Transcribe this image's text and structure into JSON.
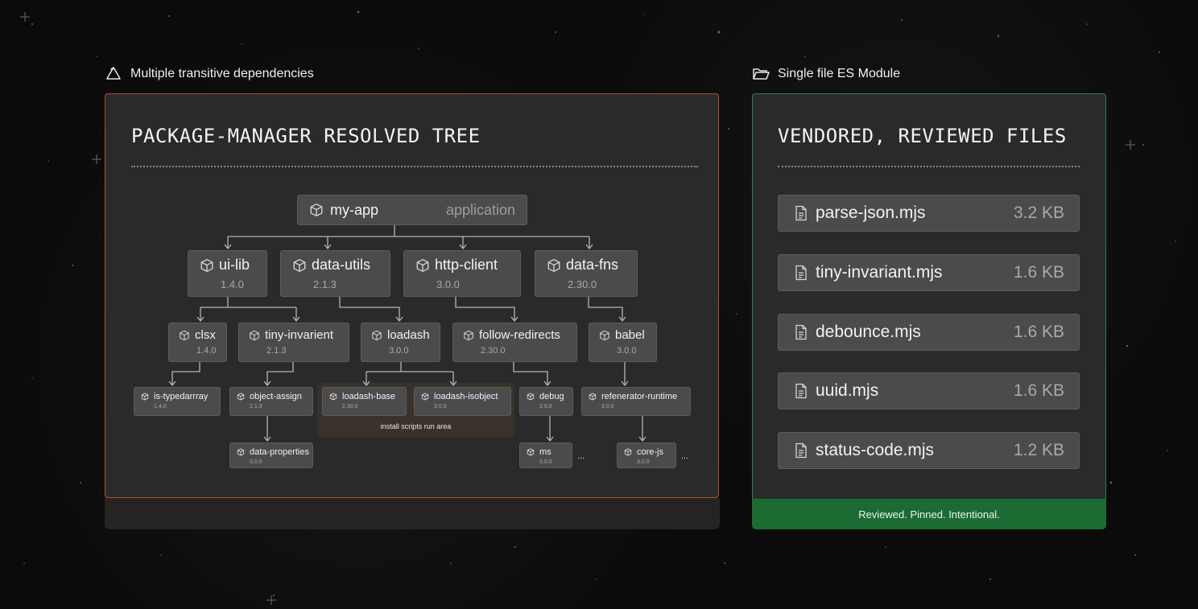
{
  "left": {
    "caption": "Multiple transitive dependencies",
    "title": "PACKAGE-MANAGER RESOLVED TREE",
    "root": {
      "name": "my-app",
      "role": "application"
    },
    "level1": [
      {
        "name": "ui-lib",
        "version": "1.4.0"
      },
      {
        "name": "data-utils",
        "version": "2.1.3"
      },
      {
        "name": "http-client",
        "version": "3.0.0"
      },
      {
        "name": "data-fns",
        "version": "2.30.0"
      }
    ],
    "level2": [
      {
        "name": "clsx",
        "version": "1.4.0"
      },
      {
        "name": "tiny-invarient",
        "version": "2.1.3"
      },
      {
        "name": "loadash",
        "version": "3.0.0"
      },
      {
        "name": "follow-redirects",
        "version": "2.30.0"
      },
      {
        "name": "babel",
        "version": "3.0.0"
      }
    ],
    "level3": [
      {
        "name": "is-typedarrray",
        "version": "1.4.0"
      },
      {
        "name": "object-assign",
        "version": "2.1.3"
      },
      {
        "name": "loadash-base",
        "version": "2.30.0"
      },
      {
        "name": "loadash-isobject",
        "version": "3.0.0"
      },
      {
        "name": "debug",
        "version": "3.0.0"
      },
      {
        "name": "refenerator-runtime",
        "version": "3.0.0"
      }
    ],
    "level4": [
      {
        "name": "data-properties",
        "version": "3.0.0"
      },
      {
        "name": "ms",
        "version": "3.0.0"
      },
      {
        "name": "core-js",
        "version": "3.0.0"
      }
    ],
    "install_label": "install scripts run area",
    "ellipsis": "..."
  },
  "right": {
    "caption": "Single file ES Module",
    "title": "VENDORED, REVIEWED FILES",
    "files": [
      {
        "name": "parse-json.mjs",
        "size": "3.2 KB"
      },
      {
        "name": "tiny-invariant.mjs",
        "size": "1.6 KB"
      },
      {
        "name": "debounce.mjs",
        "size": "1.6 KB"
      },
      {
        "name": "uuid.mjs",
        "size": "1.6 KB"
      },
      {
        "name": "status-code.mjs",
        "size": "1.2 KB"
      }
    ],
    "footer": "Reviewed. Pinned. Intentional."
  },
  "colors": {
    "left_border": "#b2502e",
    "right_border": "#2e7d45",
    "footer_bg": "#1c6b33",
    "install_area": "#3a322a"
  },
  "icons": [
    "recycle-icon",
    "folder-icon",
    "package-icon",
    "file-icon"
  ]
}
